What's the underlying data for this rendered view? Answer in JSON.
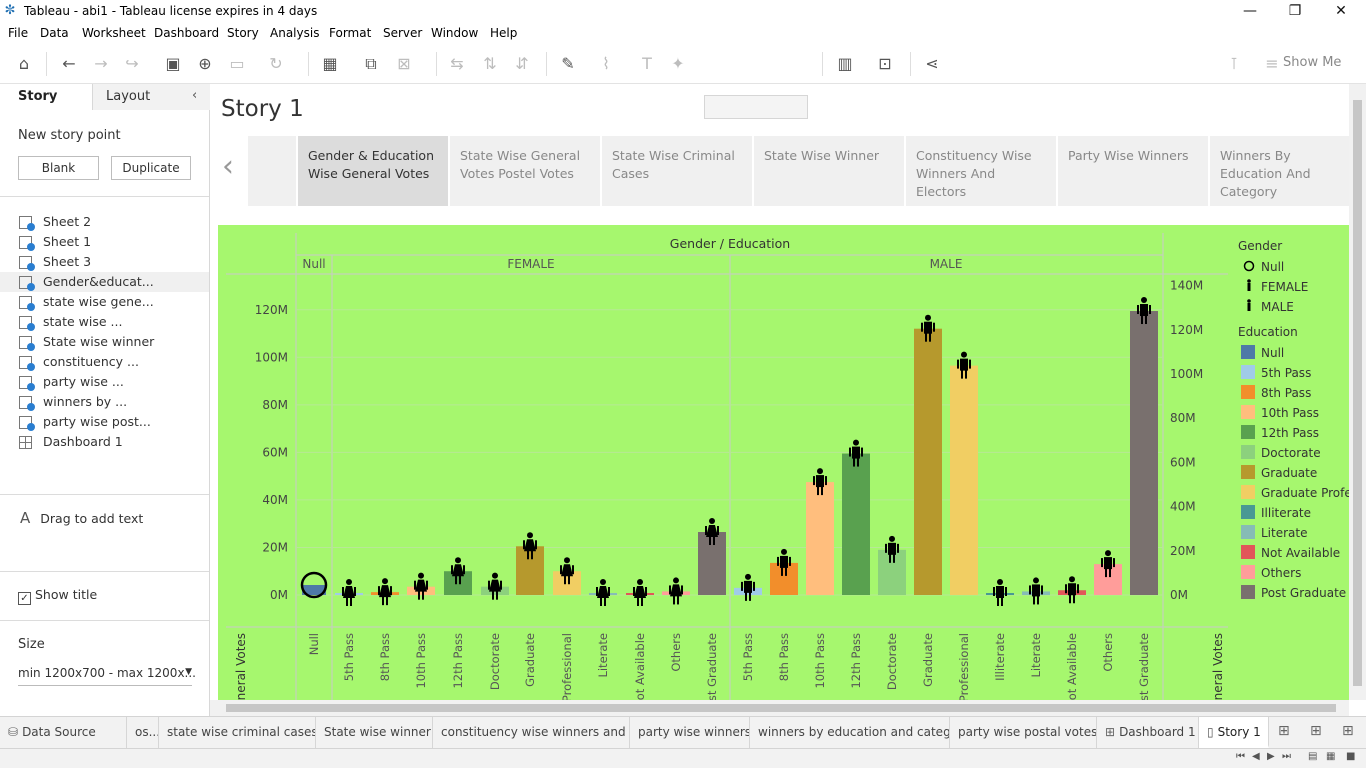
{
  "window": {
    "title": "Tableau - abi1 - Tableau license expires in 4 days",
    "minimize": "—",
    "maximize": "❐",
    "close": "✕"
  },
  "menu": [
    "File",
    "Data",
    "Worksheet",
    "Dashboard",
    "Story",
    "Analysis",
    "Format",
    "Server",
    "Window",
    "Help"
  ],
  "toolbar": {
    "show_me": "Show Me"
  },
  "sidebar": {
    "tab_story": "Story",
    "tab_layout": "Layout",
    "new_story_point": "New story point",
    "blank_button": "Blank",
    "duplicate_button": "Duplicate",
    "sheets": [
      {
        "label": "Sheet 2",
        "type": "sheet"
      },
      {
        "label": "Sheet 1",
        "type": "sheet"
      },
      {
        "label": "Sheet 3",
        "type": "sheet"
      },
      {
        "label": "Gender&educat...",
        "type": "sheet"
      },
      {
        "label": "state wise gene...",
        "type": "sheet"
      },
      {
        "label": "state wise ...",
        "type": "sheet"
      },
      {
        "label": "State wise winner",
        "type": "sheet"
      },
      {
        "label": " constituency ...",
        "type": "sheet"
      },
      {
        "label": "party wise ...",
        "type": "sheet"
      },
      {
        "label": "winners by ...",
        "type": "sheet"
      },
      {
        "label": "party wise post...",
        "type": "sheet"
      },
      {
        "label": "Dashboard 1",
        "type": "dashboard"
      }
    ],
    "drag_text": "Drag to add text",
    "drag_icon": "A",
    "show_title": "Show title",
    "size_label": "Size",
    "size_value": "min 1200x700 - max 1200x..."
  },
  "story": {
    "title": "Story 1",
    "points": [
      "Gender & Education Wise General Votes",
      "State Wise General Votes Postel Votes",
      "State Wise Criminal Cases",
      "State Wise Winner",
      "Constituency Wise Winners And Electors",
      "Party Wise Winners",
      "Winners By Education And Category"
    ]
  },
  "chart_data": {
    "type": "bar",
    "title": "Gender / Education",
    "ylabel": "General Votes",
    "ylabel_right": "General Votes",
    "left_ticks": [
      "0M",
      "20M",
      "40M",
      "60M",
      "80M",
      "100M",
      "120M"
    ],
    "right_ticks": [
      "0M",
      "20M",
      "40M",
      "60M",
      "80M",
      "100M",
      "120M",
      "140M"
    ],
    "ylim": [
      0,
      140
    ],
    "panels": [
      "Null",
      "FEMALE",
      "MALE"
    ],
    "background": "#a6f76e",
    "categories": [
      {
        "gender": "Null",
        "education": "Null",
        "value": 3.5,
        "color": "#4e79a7"
      },
      {
        "gender": "FEMALE",
        "education": "5th Pass",
        "value": 0.8,
        "color": "#a0cbe8"
      },
      {
        "gender": "FEMALE",
        "education": "8th Pass",
        "value": 1.2,
        "color": "#f28e2b"
      },
      {
        "gender": "FEMALE",
        "education": "10th Pass",
        "value": 3.5,
        "color": "#ffbe7d"
      },
      {
        "gender": "FEMALE",
        "education": "12th Pass",
        "value": 10,
        "color": "#59a14f"
      },
      {
        "gender": "FEMALE",
        "education": "Doctorate",
        "value": 3.5,
        "color": "#8cd17d"
      },
      {
        "gender": "FEMALE",
        "education": "Graduate",
        "value": 20.5,
        "color": "#b6992d"
      },
      {
        "gender": "FEMALE",
        "education": "Professional",
        "value": 10,
        "color": "#f1ce63"
      },
      {
        "gender": "FEMALE",
        "education": "Literate",
        "value": 0.3,
        "color": "#86bcb6"
      },
      {
        "gender": "FEMALE",
        "education": "Not Available",
        "value": 0.2,
        "color": "#e15759"
      },
      {
        "gender": "FEMALE",
        "education": "Others",
        "value": 1.5,
        "color": "#ff9d9a"
      },
      {
        "gender": "FEMALE",
        "education": "Post Graduate",
        "value": 26.5,
        "color": "#79706e"
      },
      {
        "gender": "MALE",
        "education": "5th Pass",
        "value": 3,
        "color": "#a0cbe8"
      },
      {
        "gender": "MALE",
        "education": "8th Pass",
        "value": 13.5,
        "color": "#f28e2b"
      },
      {
        "gender": "MALE",
        "education": "10th Pass",
        "value": 47.5,
        "color": "#ffbe7d"
      },
      {
        "gender": "MALE",
        "education": "12th Pass",
        "value": 59.5,
        "color": "#59a14f"
      },
      {
        "gender": "MALE",
        "education": "Doctorate",
        "value": 19,
        "color": "#8cd17d"
      },
      {
        "gender": "MALE",
        "education": "Graduate",
        "value": 120.5,
        "color": "#b6992d"
      },
      {
        "gender": "MALE",
        "education": "Professional",
        "value": 96.5,
        "color": "#f1ce63"
      },
      {
        "gender": "MALE",
        "education": "Illiterate",
        "value": 0.5,
        "color": "#499894"
      },
      {
        "gender": "MALE",
        "education": "Literate",
        "value": 1.5,
        "color": "#86bcb6"
      },
      {
        "gender": "MALE",
        "education": "Not Available",
        "value": 2,
        "color": "#e15759"
      },
      {
        "gender": "MALE",
        "education": "Others",
        "value": 13,
        "color": "#ff9d9a"
      },
      {
        "gender": "MALE",
        "education": "Post Graduate",
        "value": 128.5,
        "color": "#79706e"
      }
    ],
    "x_tick_labels": [
      "Null",
      "5th Pass",
      "8th Pass",
      "10th Pass",
      "12th Pass",
      "Doctorate",
      "Graduate",
      "Professional",
      "Literate",
      "ot Available",
      "Others",
      "st Graduate",
      "5th Pass",
      "8th Pass",
      "10th Pass",
      "12th Pass",
      "Doctorate",
      "Graduate",
      "Professional",
      "Illiterate",
      "Literate",
      "ot Available",
      "Others",
      "st Graduate"
    ],
    "legend_gender": {
      "title": "Gender",
      "items": [
        "Null",
        "FEMALE",
        "MALE"
      ]
    },
    "legend_education": {
      "title": "Education",
      "items": [
        {
          "label": "Null",
          "color": "#4e79a7"
        },
        {
          "label": "5th Pass",
          "color": "#a0cbe8"
        },
        {
          "label": "8th Pass",
          "color": "#f28e2b"
        },
        {
          "label": "10th Pass",
          "color": "#ffbe7d"
        },
        {
          "label": "12th Pass",
          "color": "#59a14f"
        },
        {
          "label": "Doctorate",
          "color": "#8cd17d"
        },
        {
          "label": "Graduate",
          "color": "#b6992d"
        },
        {
          "label": "Graduate Profes",
          "color": "#f1ce63"
        },
        {
          "label": "Illiterate",
          "color": "#499894"
        },
        {
          "label": "Literate",
          "color": "#86bcb6"
        },
        {
          "label": "Not Available",
          "color": "#e15759"
        },
        {
          "label": "Others",
          "color": "#ff9d9a"
        },
        {
          "label": "Post Graduate",
          "color": "#79706e"
        }
      ]
    }
  },
  "bottom_tabs": [
    {
      "label": "Data Source",
      "icon": "database-icon"
    },
    {
      "label": "os...",
      "icon": ""
    },
    {
      "label": "state wise criminal cases",
      "icon": ""
    },
    {
      "label": "State wise winner",
      "icon": ""
    },
    {
      "label": "constituency wise winners and ...",
      "icon": ""
    },
    {
      "label": "party wise winners",
      "icon": ""
    },
    {
      "label": "winners by education and categ...",
      "icon": ""
    },
    {
      "label": "party wise postal votes",
      "icon": ""
    },
    {
      "label": "Dashboard 1",
      "icon": "dashboard-icon"
    },
    {
      "label": "Story 1",
      "icon": "story-icon"
    }
  ]
}
